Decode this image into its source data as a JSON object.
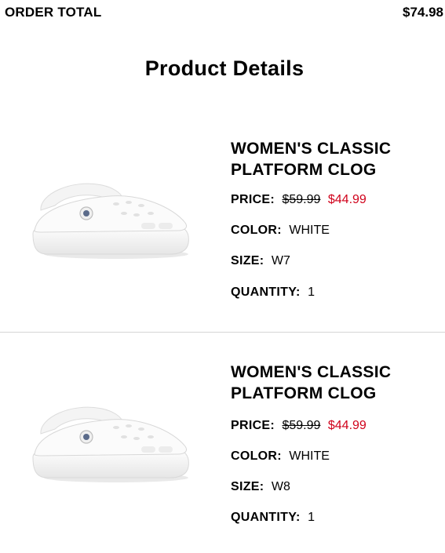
{
  "order_total": {
    "label": "ORDER TOTAL",
    "value": "$74.98"
  },
  "section_title": "Product Details",
  "products": [
    {
      "name": "WOMEN'S CLASSIC PLATFORM CLOG",
      "price_label": "PRICE:",
      "original_price": "$59.99",
      "sale_price": "$44.99",
      "color_label": "COLOR:",
      "color": "WHITE",
      "size_label": "SIZE:",
      "size": "W7",
      "quantity_label": "QUANTITY:",
      "quantity": "1",
      "image_icon": "white-platform-clog"
    },
    {
      "name": "WOMEN'S CLASSIC PLATFORM CLOG",
      "price_label": "PRICE:",
      "original_price": "$59.99",
      "sale_price": "$44.99",
      "color_label": "COLOR:",
      "color": "WHITE",
      "size_label": "SIZE:",
      "size": "W8",
      "quantity_label": "QUANTITY:",
      "quantity": "1",
      "image_icon": "white-platform-clog"
    }
  ],
  "colors": {
    "sale_price": "#d0021b",
    "divider": "#d6d6d6"
  }
}
